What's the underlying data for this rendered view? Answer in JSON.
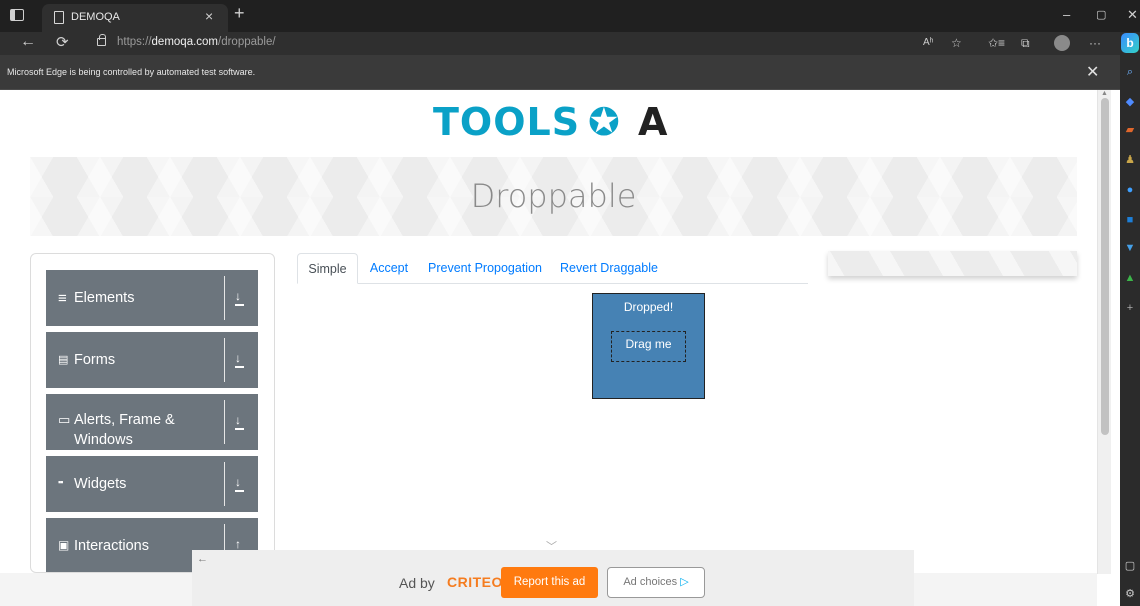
{
  "browser": {
    "tab_title": "DEMOQA",
    "tab_close": "×",
    "new_tab": "+",
    "url_scheme": "https://",
    "url_host": "demoqa.com",
    "url_path": "/droppable/",
    "minimize": "–",
    "restore": "▢",
    "close": "✕",
    "infobar_text": "Microsoft Edge is being controlled by automated test software.",
    "infobar_close": "✕",
    "tools": {
      "read_aloud": "Aʰ",
      "favorite": "☆",
      "favorites": "✩≡",
      "collections": "⧉",
      "more": "···"
    },
    "copilot": "b"
  },
  "page": {
    "logo_text": "TOOLS",
    "logo_gear": "✪",
    "logo_a": "A",
    "title": "Droppable",
    "groups": [
      {
        "icon": "≡",
        "label": "Elements",
        "arrow": "down"
      },
      {
        "icon": "▤",
        "label": "Forms",
        "arrow": "down"
      },
      {
        "icon": "▭",
        "label": "Alerts, Frame &",
        "label2": "Windows",
        "arrow": "down"
      },
      {
        "icon": "▪▪",
        "label": "Widgets",
        "arrow": "down"
      },
      {
        "icon": "▣",
        "label": "Interactions",
        "arrow": "up"
      }
    ],
    "tabs": [
      {
        "label": "Simple",
        "active": true
      },
      {
        "label": "Accept",
        "active": false
      },
      {
        "label": "Prevent Propogation",
        "active": false
      },
      {
        "label": "Revert Draggable",
        "active": false
      }
    ],
    "drop_label": "Dropped!",
    "drag_label": "Drag me",
    "drop_color": "#4682b4"
  },
  "ad": {
    "back": "←",
    "by": "Ad by",
    "brand": "CRITEO",
    "report": "Report this ad",
    "choices": "Ad choices",
    "choices_icon": "▷"
  }
}
